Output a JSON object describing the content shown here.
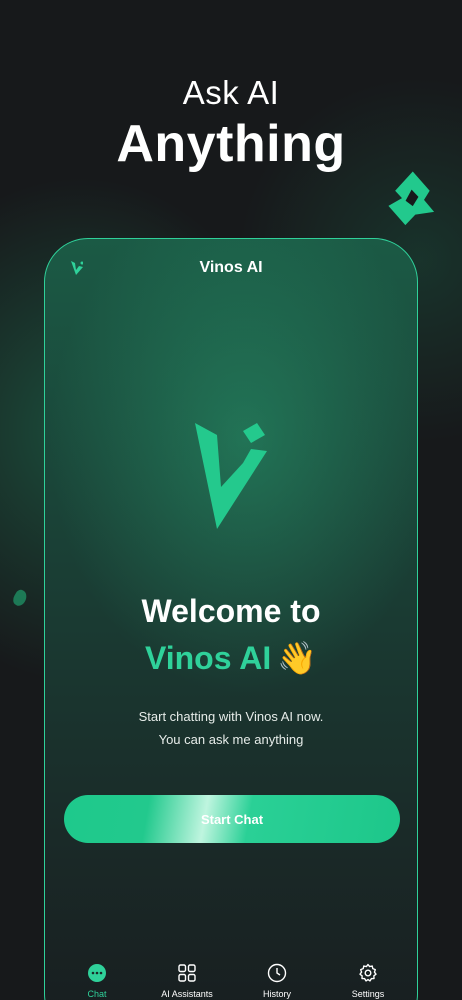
{
  "hero": {
    "line1": "Ask AI",
    "line2": "Anything"
  },
  "phone": {
    "title": "Vinos AI",
    "welcome_line1": "Welcome to",
    "welcome_brand": "Vinos AI",
    "welcome_emoji": "👋",
    "subtitle_line1": "Start chatting with Vinos AI now.",
    "subtitle_line2": "You can ask me anything",
    "start_button": "Start Chat"
  },
  "tabs": [
    {
      "label": "Chat",
      "icon": "chat-bubble-icon",
      "active": true
    },
    {
      "label": "AI Assistants",
      "icon": "grid-icon",
      "active": false
    },
    {
      "label": "History",
      "icon": "clock-icon",
      "active": false
    },
    {
      "label": "Settings",
      "icon": "gear-icon",
      "active": false
    }
  ],
  "colors": {
    "accent": "#2fd19a",
    "background": "#17191b",
    "text": "#ffffff"
  }
}
